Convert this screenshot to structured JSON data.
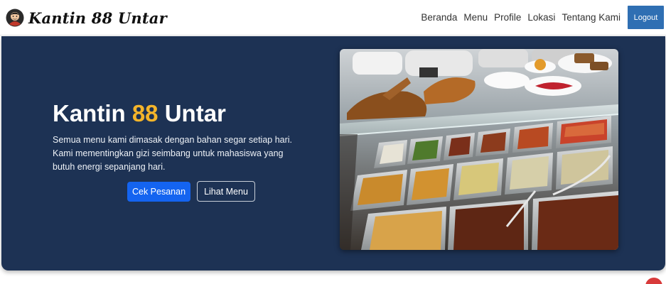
{
  "brand": {
    "name": "Kantin 88 Untar",
    "logo_icon": "chef-avatar-icon"
  },
  "nav": {
    "links": [
      "Beranda",
      "Menu",
      "Profile",
      "Lokasi",
      "Tentang Kami"
    ],
    "logout_label": "Logout"
  },
  "hero": {
    "title_before": "Kantin ",
    "title_accent": "88",
    "title_after": " Untar",
    "description": "Semua menu kami dimasak dengan bahan segar setiap hari. Kami mementingkan gizi seimbang untuk mahasiswa yang butuh energi sepanjang hari.",
    "primary_button": "Cek Pesanan",
    "secondary_button": "Lihat Menu",
    "image_subject": "food-display-case-photo"
  },
  "colors": {
    "hero_background": "#1d3254",
    "accent": "#f4b42a",
    "primary_button": "#1464f0",
    "logout_button": "#2f6fb3"
  }
}
